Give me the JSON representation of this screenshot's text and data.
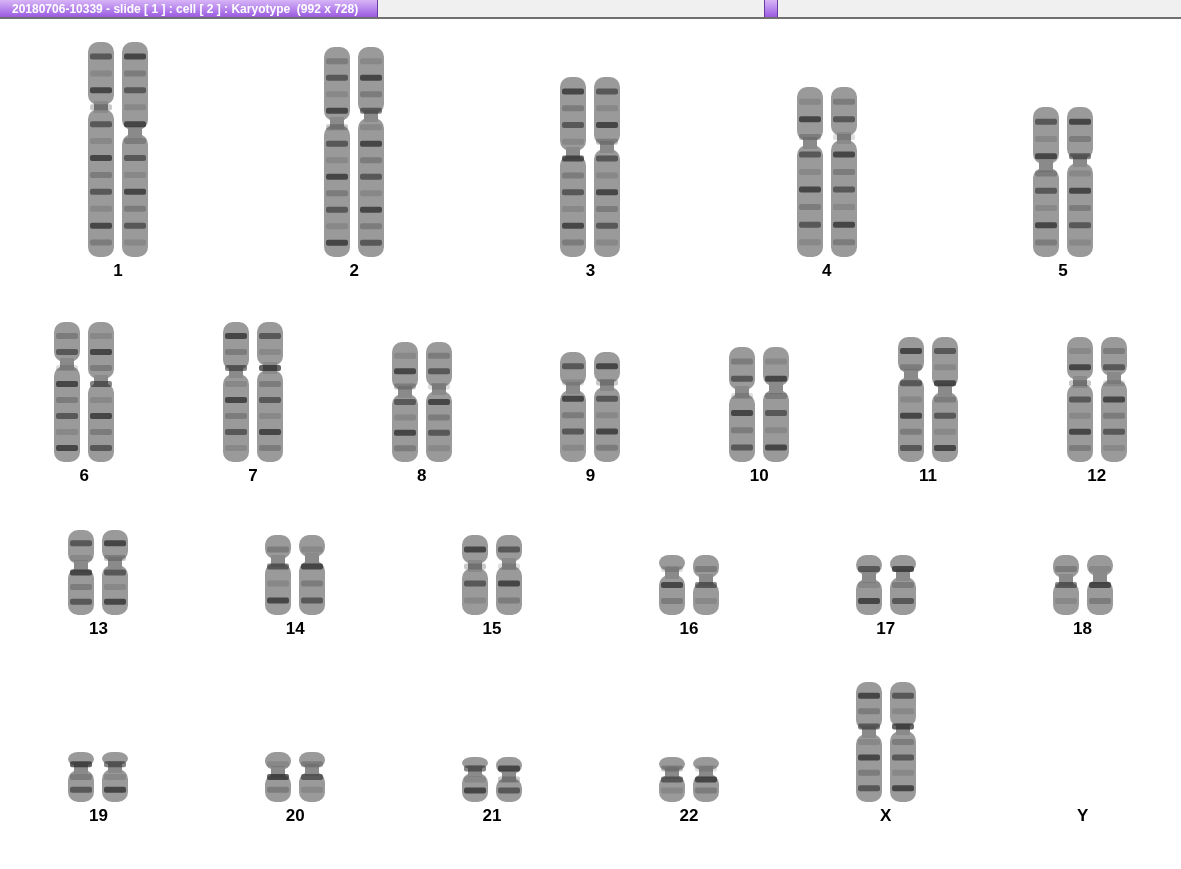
{
  "window": {
    "title": "20180706-10339 - slide [ 1 ] : cell [ 2 ] : Karyotype  (992 x 728)"
  },
  "rows": [
    [
      {
        "label": "1",
        "present": true
      },
      {
        "label": "2",
        "present": true
      },
      {
        "label": "3",
        "present": true
      },
      {
        "label": "4",
        "present": true
      },
      {
        "label": "5",
        "present": true
      }
    ],
    [
      {
        "label": "6",
        "present": true
      },
      {
        "label": "7",
        "present": true
      },
      {
        "label": "8",
        "present": true
      },
      {
        "label": "9",
        "present": true
      },
      {
        "label": "10",
        "present": true
      },
      {
        "label": "11",
        "present": true
      },
      {
        "label": "12",
        "present": true
      }
    ],
    [
      {
        "label": "13",
        "present": true
      },
      {
        "label": "14",
        "present": true
      },
      {
        "label": "15",
        "present": true
      },
      {
        "label": "16",
        "present": true
      },
      {
        "label": "17",
        "present": true
      },
      {
        "label": "18",
        "present": true
      }
    ],
    [
      {
        "label": "19",
        "present": true
      },
      {
        "label": "20",
        "present": true
      },
      {
        "label": "21",
        "present": true
      },
      {
        "label": "22",
        "present": true
      },
      {
        "label": "X",
        "present": true
      },
      {
        "label": "Y",
        "present": false
      }
    ]
  ]
}
